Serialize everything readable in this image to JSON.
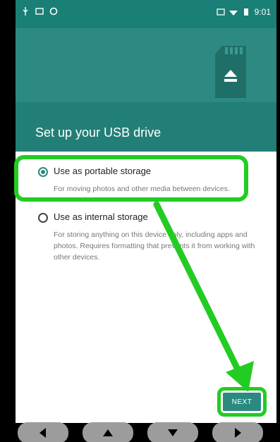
{
  "status_bar": {
    "time": "9:01",
    "left_icons": [
      "usb-icon",
      "screenshot-icon",
      "sync-icon"
    ],
    "right_icons": [
      "cast-icon",
      "wifi-icon",
      "battery-icon"
    ]
  },
  "header": {
    "title": "Set up your USB drive",
    "colors": {
      "header": "#227f77",
      "band": "#2c8a82"
    }
  },
  "options": [
    {
      "label": "Use as portable storage",
      "description": "For moving photos and other media between devices.",
      "selected": true
    },
    {
      "label": "Use as internal storage",
      "description": "For storing anything on this device only, including apps and photos. Requires formatting that prevents it from working with other devices.",
      "selected": false
    }
  ],
  "footer": {
    "next_label": "NEXT"
  },
  "highlight_color": "#22cc22",
  "nav_buttons": [
    "left-arrow-icon",
    "up-arrow-icon",
    "down-arrow-icon",
    "right-arrow-icon"
  ]
}
